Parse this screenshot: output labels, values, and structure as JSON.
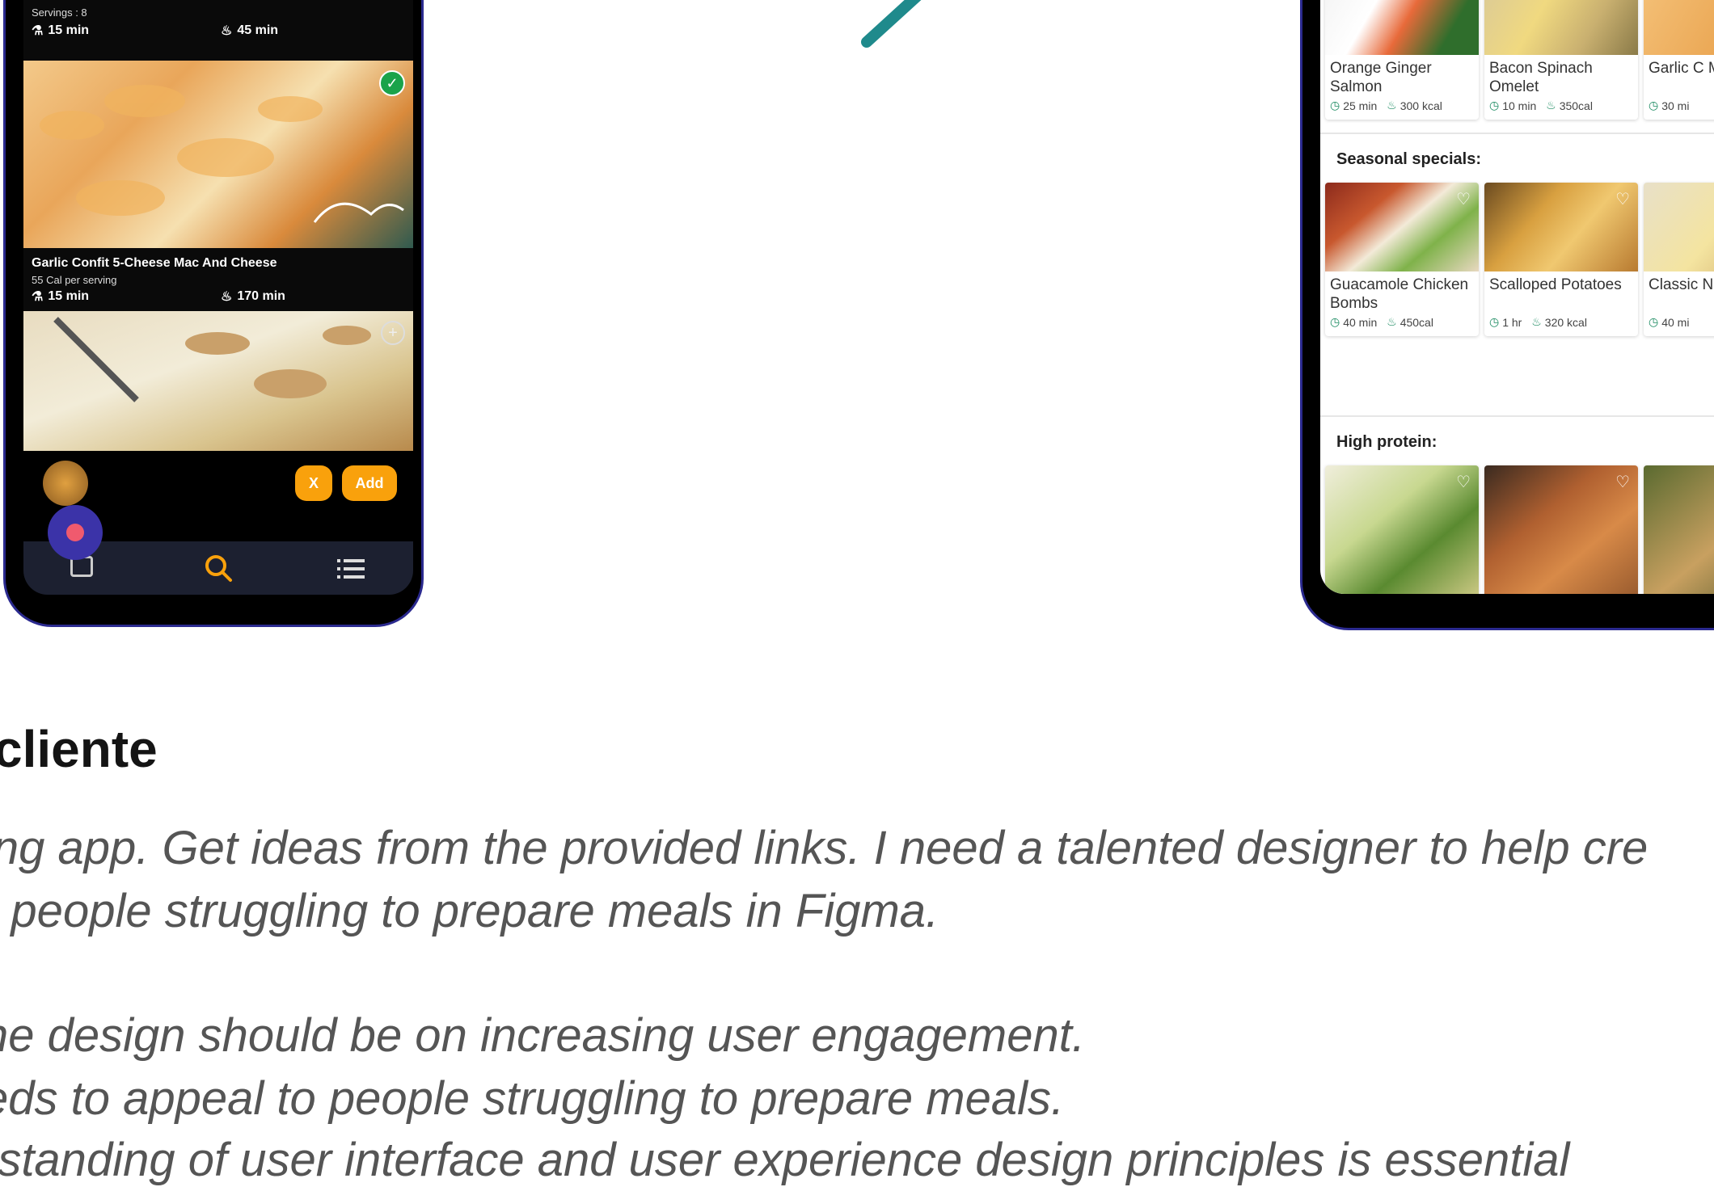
{
  "left_phone": {
    "top_recipe": {
      "servings": "Servings : 8",
      "prep": "15 min",
      "cook": "45 min"
    },
    "recipe2": {
      "title": "Garlic Confit 5-Cheese Mac And Cheese",
      "subtitle": "55 Cal per serving",
      "prep": "15 min",
      "cook": "170 min"
    },
    "buttons": {
      "x_label": "X",
      "add_label": "Add"
    },
    "colors": {
      "accent": "#f9a10c",
      "selected": "#1aa34a",
      "fab": "#3b33a8"
    }
  },
  "right_phone": {
    "sections": [
      {
        "title": "",
        "cards": [
          {
            "name": "Orange Ginger Salmon",
            "time": "25 min",
            "kcal": "300 kcal"
          },
          {
            "name": "Bacon Spinach Omelet",
            "time": "10 min",
            "kcal": "350cal"
          },
          {
            "name": "Garlic C Mac an",
            "time": "30 mi",
            "kcal": ""
          }
        ]
      },
      {
        "title": "Seasonal specials:",
        "cards": [
          {
            "name": "Guacamole Chicken Bombs",
            "time": "40 min",
            "kcal": "450cal"
          },
          {
            "name": "Scalloped Potatoes",
            "time": "1 hr",
            "kcal": "320 kcal"
          },
          {
            "name": "Classic Noodle",
            "time": "40 mi",
            "kcal": ""
          }
        ]
      },
      {
        "title": "High protein:",
        "cards": []
      }
    ]
  },
  "text": {
    "title": "cliente",
    "lines": [
      "ing app. Get ideas from the provided links. I need a   talented designer to help cre",
      "r people  struggling to prepare meals in Figma.",
      "he design  should be on increasing user engagement.",
      "eds to appeal  to people struggling to prepare meals.",
      "rstanding of  user interface and user experience design principles is essential"
    ]
  }
}
